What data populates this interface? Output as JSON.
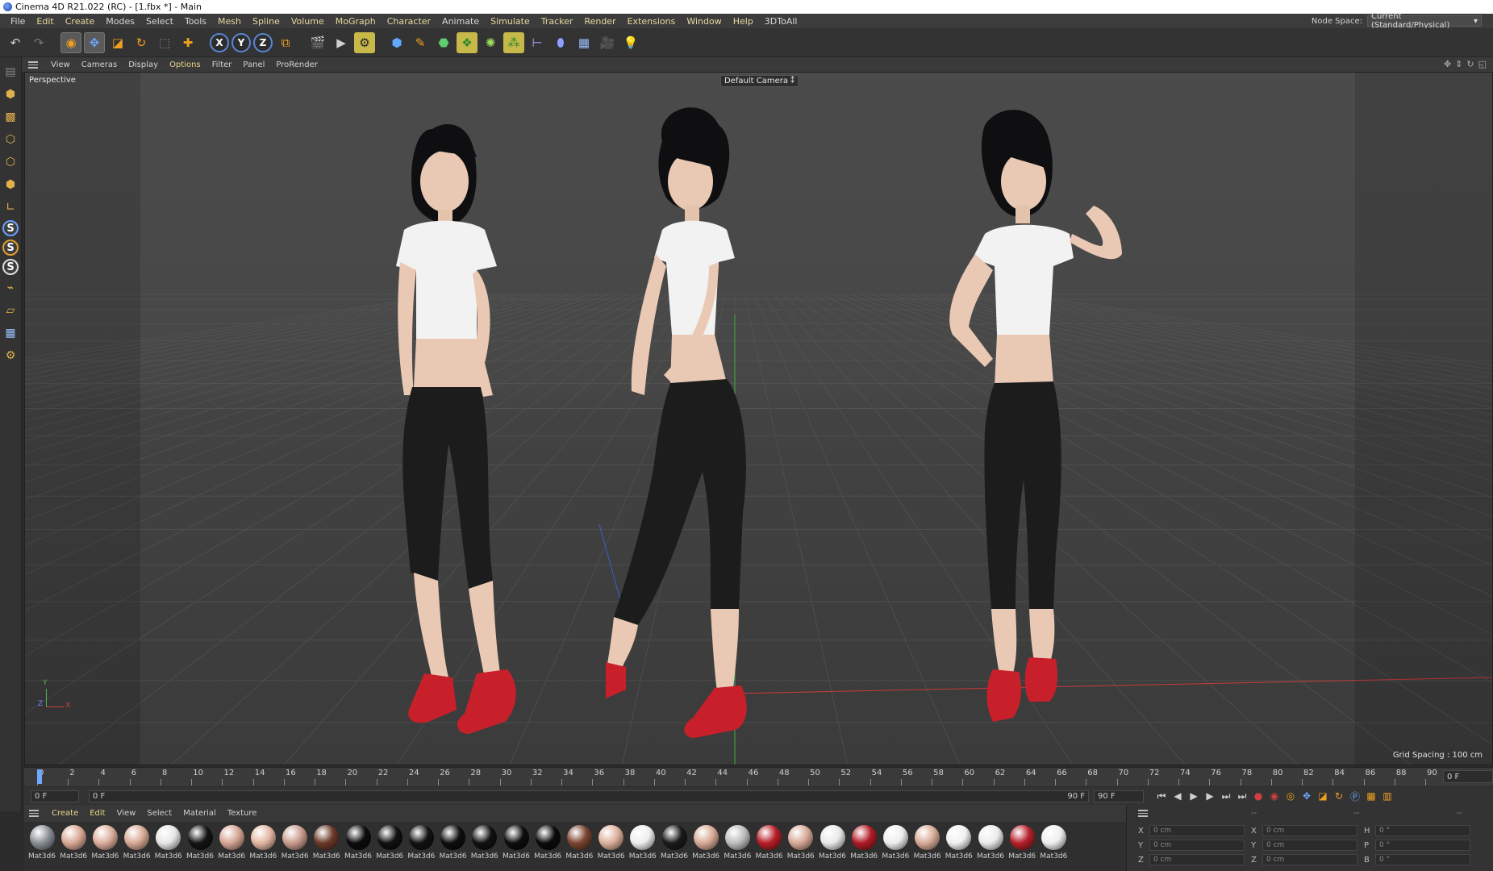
{
  "window": {
    "title": "Cinema 4D R21.022 (RC) - [1.fbx *] - Main"
  },
  "menubar": {
    "items": [
      "File",
      "Edit",
      "Create",
      "Modes",
      "Select",
      "Tools",
      "Mesh",
      "Spline",
      "Volume",
      "MoGraph",
      "Character",
      "Animate",
      "Simulate",
      "Tracker",
      "Render",
      "Extensions",
      "Window",
      "Help",
      "3DToAll"
    ],
    "node_space_label": "Node Space:",
    "node_space_value": "Current (Standard/Physical)"
  },
  "toolbar": {
    "icons": [
      "undo-icon",
      "redo-icon",
      "live-selection-icon",
      "move-icon",
      "scale-icon",
      "rotate-icon",
      "recent-tool-icon",
      "add-icon",
      "x-axis-icon",
      "y-axis-icon",
      "z-axis-icon",
      "coordinate-system-icon",
      "render-view-icon",
      "render-picture-viewer-icon",
      "render-settings-icon",
      "cube-icon",
      "pen-icon",
      "subdivision-icon",
      "array-icon",
      "mograph-icon",
      "cloner-icon",
      "deformer-icon",
      "field-icon",
      "floor-icon",
      "camera-icon",
      "light-icon"
    ],
    "axis_labels": [
      "X",
      "Y",
      "Z"
    ]
  },
  "viewport_menu": {
    "items": [
      "View",
      "Cameras",
      "Display",
      "Options",
      "Filter",
      "Panel",
      "ProRender"
    ],
    "active": "Options"
  },
  "viewport": {
    "name": "Perspective",
    "camera": "Default Camera",
    "grid_spacing": "Grid Spacing : 100 cm",
    "axis_y": "Y",
    "axis_z": "Z",
    "axis_x": "X",
    "colors": {
      "shirt": "#f2f2f2",
      "pants": "#1c1c1c",
      "shoes": "#c8202a",
      "skin": "#e9c9b4",
      "hair": "#0f0f12"
    }
  },
  "timeline": {
    "ticks": [
      "0",
      "2",
      "4",
      "6",
      "8",
      "10",
      "12",
      "14",
      "16",
      "18",
      "20",
      "22",
      "24",
      "26",
      "28",
      "30",
      "32",
      "34",
      "36",
      "38",
      "40",
      "42",
      "44",
      "46",
      "48",
      "50",
      "52",
      "54",
      "56",
      "58",
      "60",
      "62",
      "64",
      "66",
      "68",
      "70",
      "72",
      "74",
      "76",
      "78",
      "80",
      "82",
      "84",
      "86",
      "88",
      "90"
    ],
    "current_frame_box": "0 F"
  },
  "transport": {
    "start_field": "0 F",
    "preview_start": "0 F",
    "preview_end": "90 F",
    "end_field": "90 F"
  },
  "material_manager": {
    "menu": [
      "Create",
      "Edit",
      "View",
      "Select",
      "Material",
      "Texture"
    ],
    "active": "Edit",
    "material_label": "Mat3d6",
    "swatches": [
      "#8a8f96",
      "#d9a893",
      "#dcae9c",
      "#d7a994",
      "#e6e6e6",
      "#141414",
      "#d6a593",
      "#e2b7a2",
      "#c99b8e",
      "#6b3a28",
      "#0c0c0c",
      "#101010",
      "#121212",
      "#0e0e0e",
      "#111111",
      "#0d0d0d",
      "#0b0b0b",
      "#7b4430",
      "#ddb09c",
      "#eeeeee",
      "#1a1a1a",
      "#d8a995",
      "#bdbdbd",
      "#b81e28",
      "#d7a996",
      "#e9e9e9",
      "#b21b25",
      "#ededed",
      "#d8ab98",
      "#f0f0f0",
      "#ebebeb",
      "#b5202a",
      "#eeeeee"
    ]
  },
  "coordinates": {
    "headers": [
      "--",
      "--",
      "--"
    ],
    "rows": [
      {
        "a": "X",
        "av": "0 cm",
        "b": "X",
        "bv": "0 cm",
        "c": "H",
        "cv": "0 °"
      },
      {
        "a": "Y",
        "av": "0 cm",
        "b": "Y",
        "bv": "0 cm",
        "c": "P",
        "cv": "0 °"
      },
      {
        "a": "Z",
        "av": "0 cm",
        "b": "Z",
        "bv": "0 cm",
        "c": "B",
        "cv": "0 °"
      }
    ]
  }
}
